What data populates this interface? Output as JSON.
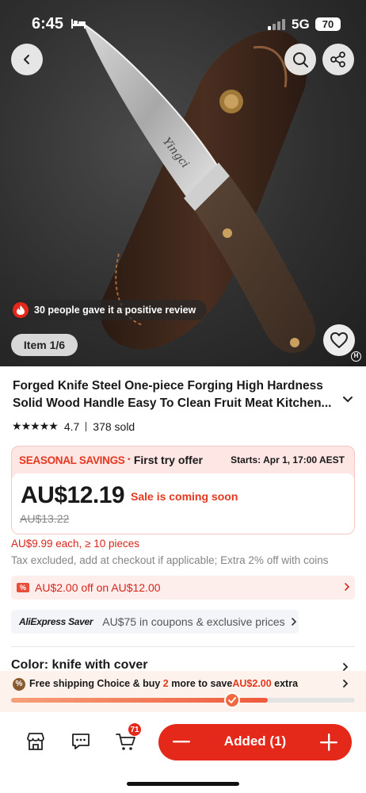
{
  "status_bar": {
    "time": "6:45",
    "network": "5G",
    "battery": "70"
  },
  "gallery": {
    "review_badge": "30 people gave it a positive review",
    "item_counter": "Item 1/6",
    "blade_brand": "Yingci"
  },
  "product": {
    "title": "Forged Knife Steel One-piece Forging High Hardness Solid Wood Handle Easy To Clean Fruit Meat Kitchen...",
    "rating": "4.7",
    "sold": "378 sold",
    "stars": 4.7
  },
  "price_card": {
    "promo_name": "SEASONAL SAVINGS",
    "promo_dot": "·",
    "promo_offer": "First try offer",
    "starts": "Starts: Apr 1, 17:00 AEST",
    "price": "AU$12.19",
    "sale_status": "Sale is coming soon",
    "original_price": "AU$13.22"
  },
  "bulk_price": "AU$9.99 each, ≥ 10 pieces",
  "tax_note": "Tax excluded, add at checkout if applicable; Extra 2% off with coins",
  "coupon": {
    "text": "AU$2.00 off on AU$12.00"
  },
  "saver": {
    "logo": "AliExpress Saver",
    "text": "AU$75 in coupons & exclusive prices"
  },
  "color_row": {
    "label": "Color: knife with cover"
  },
  "shipping": {
    "prefix": "Free shipping Choice & buy ",
    "count": "2",
    "middle": " more to save",
    "amount": "AU$2.00",
    "suffix": " extra",
    "progress": 0.83
  },
  "bottom_bar": {
    "cart_count": "71",
    "added_label": "Added (1)"
  },
  "colors": {
    "accent": "#e4281a",
    "promo_red": "#e4381f",
    "progress_start": "#f6a07a",
    "progress_end": "#ef5a3c"
  }
}
